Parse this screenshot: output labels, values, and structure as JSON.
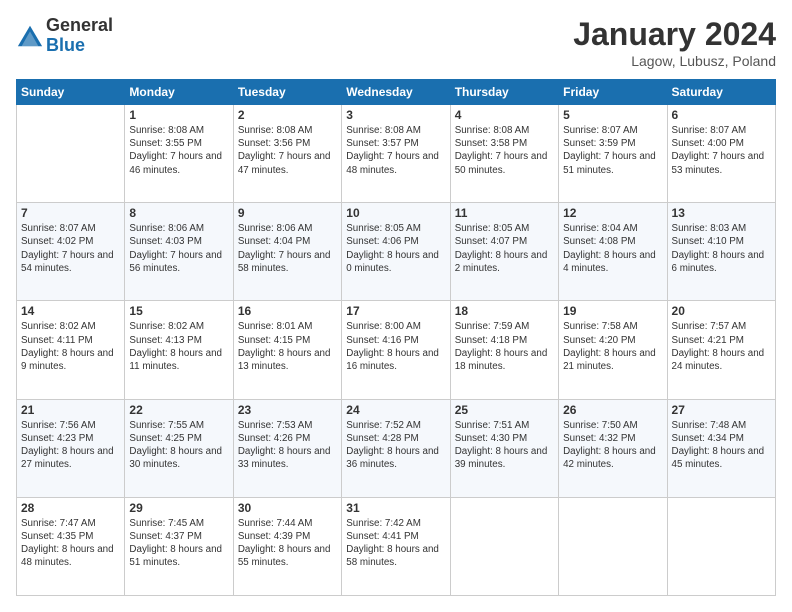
{
  "header": {
    "logo_line1": "General",
    "logo_line2": "Blue",
    "month": "January 2024",
    "location": "Lagow, Lubusz, Poland"
  },
  "weekdays": [
    "Sunday",
    "Monday",
    "Tuesday",
    "Wednesday",
    "Thursday",
    "Friday",
    "Saturday"
  ],
  "weeks": [
    [
      {
        "day": "",
        "sunrise": "",
        "sunset": "",
        "daylight": ""
      },
      {
        "day": "1",
        "sunrise": "Sunrise: 8:08 AM",
        "sunset": "Sunset: 3:55 PM",
        "daylight": "Daylight: 7 hours and 46 minutes."
      },
      {
        "day": "2",
        "sunrise": "Sunrise: 8:08 AM",
        "sunset": "Sunset: 3:56 PM",
        "daylight": "Daylight: 7 hours and 47 minutes."
      },
      {
        "day": "3",
        "sunrise": "Sunrise: 8:08 AM",
        "sunset": "Sunset: 3:57 PM",
        "daylight": "Daylight: 7 hours and 48 minutes."
      },
      {
        "day": "4",
        "sunrise": "Sunrise: 8:08 AM",
        "sunset": "Sunset: 3:58 PM",
        "daylight": "Daylight: 7 hours and 50 minutes."
      },
      {
        "day": "5",
        "sunrise": "Sunrise: 8:07 AM",
        "sunset": "Sunset: 3:59 PM",
        "daylight": "Daylight: 7 hours and 51 minutes."
      },
      {
        "day": "6",
        "sunrise": "Sunrise: 8:07 AM",
        "sunset": "Sunset: 4:00 PM",
        "daylight": "Daylight: 7 hours and 53 minutes."
      }
    ],
    [
      {
        "day": "7",
        "sunrise": "Sunrise: 8:07 AM",
        "sunset": "Sunset: 4:02 PM",
        "daylight": "Daylight: 7 hours and 54 minutes."
      },
      {
        "day": "8",
        "sunrise": "Sunrise: 8:06 AM",
        "sunset": "Sunset: 4:03 PM",
        "daylight": "Daylight: 7 hours and 56 minutes."
      },
      {
        "day": "9",
        "sunrise": "Sunrise: 8:06 AM",
        "sunset": "Sunset: 4:04 PM",
        "daylight": "Daylight: 7 hours and 58 minutes."
      },
      {
        "day": "10",
        "sunrise": "Sunrise: 8:05 AM",
        "sunset": "Sunset: 4:06 PM",
        "daylight": "Daylight: 8 hours and 0 minutes."
      },
      {
        "day": "11",
        "sunrise": "Sunrise: 8:05 AM",
        "sunset": "Sunset: 4:07 PM",
        "daylight": "Daylight: 8 hours and 2 minutes."
      },
      {
        "day": "12",
        "sunrise": "Sunrise: 8:04 AM",
        "sunset": "Sunset: 4:08 PM",
        "daylight": "Daylight: 8 hours and 4 minutes."
      },
      {
        "day": "13",
        "sunrise": "Sunrise: 8:03 AM",
        "sunset": "Sunset: 4:10 PM",
        "daylight": "Daylight: 8 hours and 6 minutes."
      }
    ],
    [
      {
        "day": "14",
        "sunrise": "Sunrise: 8:02 AM",
        "sunset": "Sunset: 4:11 PM",
        "daylight": "Daylight: 8 hours and 9 minutes."
      },
      {
        "day": "15",
        "sunrise": "Sunrise: 8:02 AM",
        "sunset": "Sunset: 4:13 PM",
        "daylight": "Daylight: 8 hours and 11 minutes."
      },
      {
        "day": "16",
        "sunrise": "Sunrise: 8:01 AM",
        "sunset": "Sunset: 4:15 PM",
        "daylight": "Daylight: 8 hours and 13 minutes."
      },
      {
        "day": "17",
        "sunrise": "Sunrise: 8:00 AM",
        "sunset": "Sunset: 4:16 PM",
        "daylight": "Daylight: 8 hours and 16 minutes."
      },
      {
        "day": "18",
        "sunrise": "Sunrise: 7:59 AM",
        "sunset": "Sunset: 4:18 PM",
        "daylight": "Daylight: 8 hours and 18 minutes."
      },
      {
        "day": "19",
        "sunrise": "Sunrise: 7:58 AM",
        "sunset": "Sunset: 4:20 PM",
        "daylight": "Daylight: 8 hours and 21 minutes."
      },
      {
        "day": "20",
        "sunrise": "Sunrise: 7:57 AM",
        "sunset": "Sunset: 4:21 PM",
        "daylight": "Daylight: 8 hours and 24 minutes."
      }
    ],
    [
      {
        "day": "21",
        "sunrise": "Sunrise: 7:56 AM",
        "sunset": "Sunset: 4:23 PM",
        "daylight": "Daylight: 8 hours and 27 minutes."
      },
      {
        "day": "22",
        "sunrise": "Sunrise: 7:55 AM",
        "sunset": "Sunset: 4:25 PM",
        "daylight": "Daylight: 8 hours and 30 minutes."
      },
      {
        "day": "23",
        "sunrise": "Sunrise: 7:53 AM",
        "sunset": "Sunset: 4:26 PM",
        "daylight": "Daylight: 8 hours and 33 minutes."
      },
      {
        "day": "24",
        "sunrise": "Sunrise: 7:52 AM",
        "sunset": "Sunset: 4:28 PM",
        "daylight": "Daylight: 8 hours and 36 minutes."
      },
      {
        "day": "25",
        "sunrise": "Sunrise: 7:51 AM",
        "sunset": "Sunset: 4:30 PM",
        "daylight": "Daylight: 8 hours and 39 minutes."
      },
      {
        "day": "26",
        "sunrise": "Sunrise: 7:50 AM",
        "sunset": "Sunset: 4:32 PM",
        "daylight": "Daylight: 8 hours and 42 minutes."
      },
      {
        "day": "27",
        "sunrise": "Sunrise: 7:48 AM",
        "sunset": "Sunset: 4:34 PM",
        "daylight": "Daylight: 8 hours and 45 minutes."
      }
    ],
    [
      {
        "day": "28",
        "sunrise": "Sunrise: 7:47 AM",
        "sunset": "Sunset: 4:35 PM",
        "daylight": "Daylight: 8 hours and 48 minutes."
      },
      {
        "day": "29",
        "sunrise": "Sunrise: 7:45 AM",
        "sunset": "Sunset: 4:37 PM",
        "daylight": "Daylight: 8 hours and 51 minutes."
      },
      {
        "day": "30",
        "sunrise": "Sunrise: 7:44 AM",
        "sunset": "Sunset: 4:39 PM",
        "daylight": "Daylight: 8 hours and 55 minutes."
      },
      {
        "day": "31",
        "sunrise": "Sunrise: 7:42 AM",
        "sunset": "Sunset: 4:41 PM",
        "daylight": "Daylight: 8 hours and 58 minutes."
      },
      {
        "day": "",
        "sunrise": "",
        "sunset": "",
        "daylight": ""
      },
      {
        "day": "",
        "sunrise": "",
        "sunset": "",
        "daylight": ""
      },
      {
        "day": "",
        "sunrise": "",
        "sunset": "",
        "daylight": ""
      }
    ]
  ]
}
